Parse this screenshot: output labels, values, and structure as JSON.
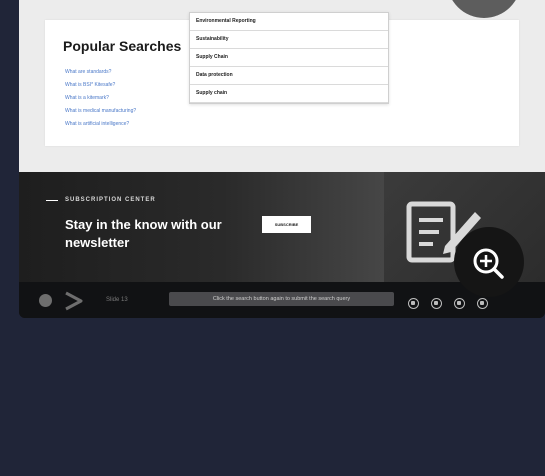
{
  "popular": {
    "title": "Popular Searches",
    "links": [
      "What are standards?",
      "What is BSI* Kitesafe?",
      "What is a kitemark?",
      "What is medical manufacturing?",
      "What is artificial intelligence?"
    ]
  },
  "dropdown": {
    "items": [
      "Environmental Reporting",
      "Sustainability",
      "Supply Chain",
      "Data protection",
      "Supply chain"
    ]
  },
  "subscription": {
    "label": "SUBSCRIPTION CENTER",
    "heading": "Stay in the know with our newsletter",
    "button": "SUBSCRIBE"
  },
  "player": {
    "slide": "Slide 13",
    "tooltip": "Click the search button again to submit the search query",
    "icons": [
      "captions-icon",
      "info-icon",
      "settings-icon",
      "menu-icon"
    ]
  },
  "colors": {
    "background": "#202538",
    "card": "#ffffff",
    "link": "#4a78c8",
    "dark_band": "#1e1e1e"
  }
}
